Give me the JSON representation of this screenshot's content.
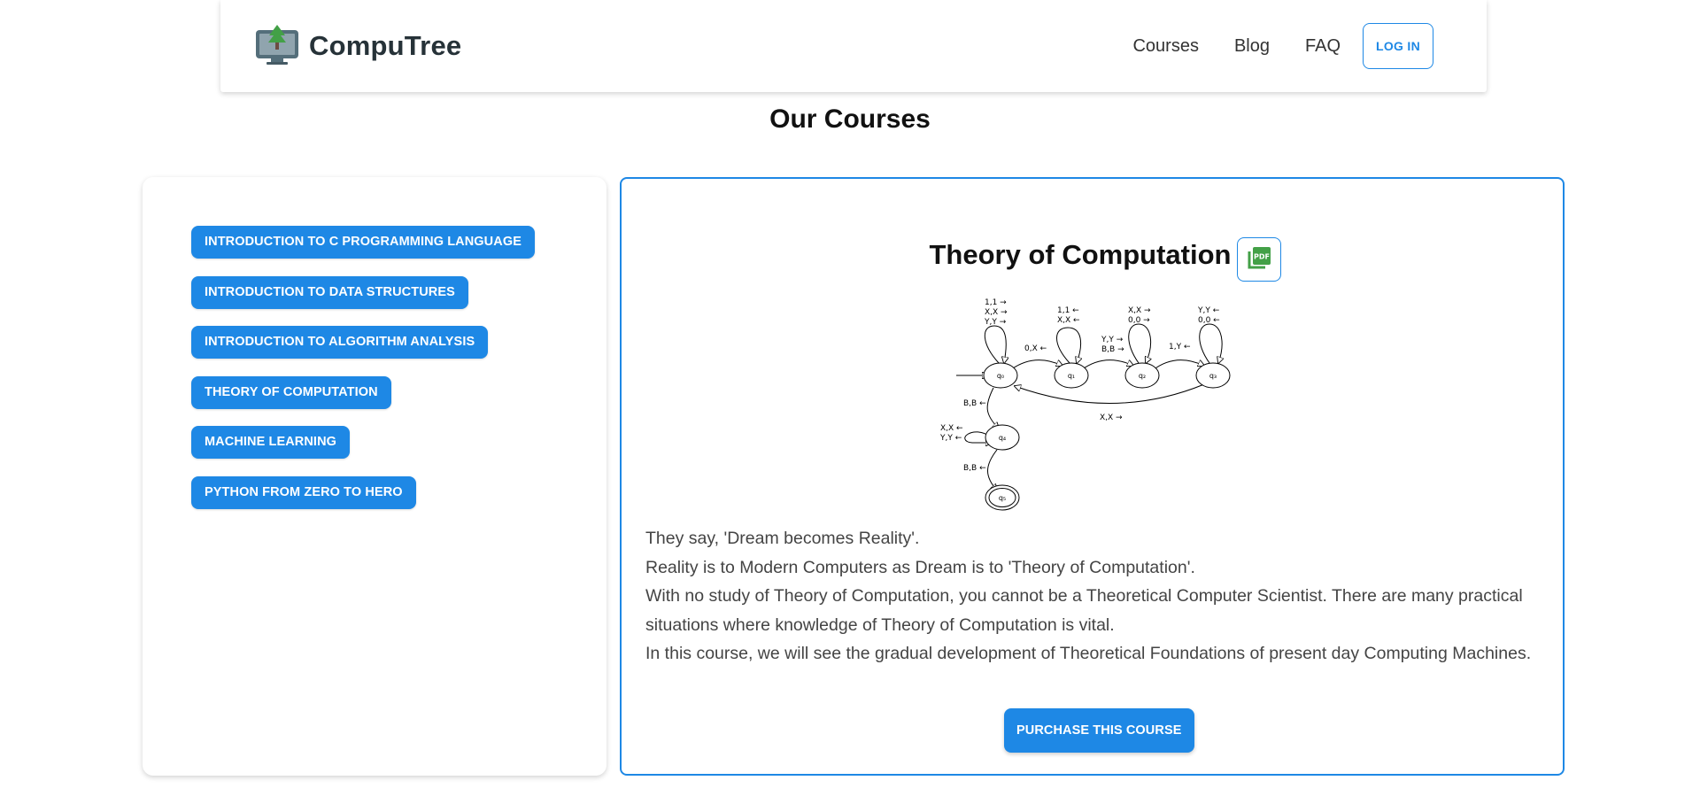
{
  "brand": {
    "name": "CompuTree",
    "logo_icon": "monitor-tree-icon"
  },
  "nav": {
    "links": [
      {
        "label": "Courses"
      },
      {
        "label": "Blog"
      },
      {
        "label": "FAQ"
      }
    ],
    "login_label": "LOG IN"
  },
  "page_title": "Our Courses",
  "sidebar": {
    "courses": [
      {
        "label": "INTRODUCTION TO C PROGRAMMING LANGUAGE"
      },
      {
        "label": "INTRODUCTION TO DATA STRUCTURES"
      },
      {
        "label": "INTRODUCTION TO ALGORITHM ANALYSIS"
      },
      {
        "label": "THEORY OF COMPUTATION"
      },
      {
        "label": "MACHINE LEARNING"
      },
      {
        "label": "PYTHON FROM ZERO TO HERO"
      }
    ]
  },
  "detail": {
    "title": "Theory of Computation",
    "pdf_icon": "pdf-icon",
    "diagram": {
      "states": [
        "q0",
        "q1",
        "q2",
        "q3",
        "q4",
        "q5"
      ],
      "labels": {
        "q0_loop": [
          "1,1 →",
          "X,X →",
          "Y,Y →"
        ],
        "q0_q1": "0,X ←",
        "q1_loop": [
          "1,1 ←",
          "X,X ←"
        ],
        "q1_q2": [
          "Y,Y →",
          "B,B →"
        ],
        "q2_loop": [
          "X,X →",
          "0,0 →"
        ],
        "q2_q3": "1,Y ←",
        "q3_loop": [
          "Y,Y ←",
          "0,0 ←"
        ],
        "q3_q0": "X,X →",
        "q0_q4": "B,B ←",
        "q4_loop": [
          "X,X ←",
          "Y,Y ←"
        ],
        "q4_q5": "B,B ←"
      }
    },
    "description": [
      "They say, 'Dream becomes Reality'.",
      "Reality is to Modern Computers as Dream is to 'Theory of Computation'.",
      "With no study of Theory of Computation, you cannot be a Theoretical Computer Scientist. There are many practical situations where knowledge of Theory of Computation is vital.",
      "In this course, we will see the gradual development of Theoretical Foundations of present day Computing Machines."
    ],
    "purchase_label": "PURCHASE THIS COURSE"
  },
  "colors": {
    "primary": "#1e88e5",
    "brand_text": "#263238",
    "pdf_green": "#43a047"
  }
}
